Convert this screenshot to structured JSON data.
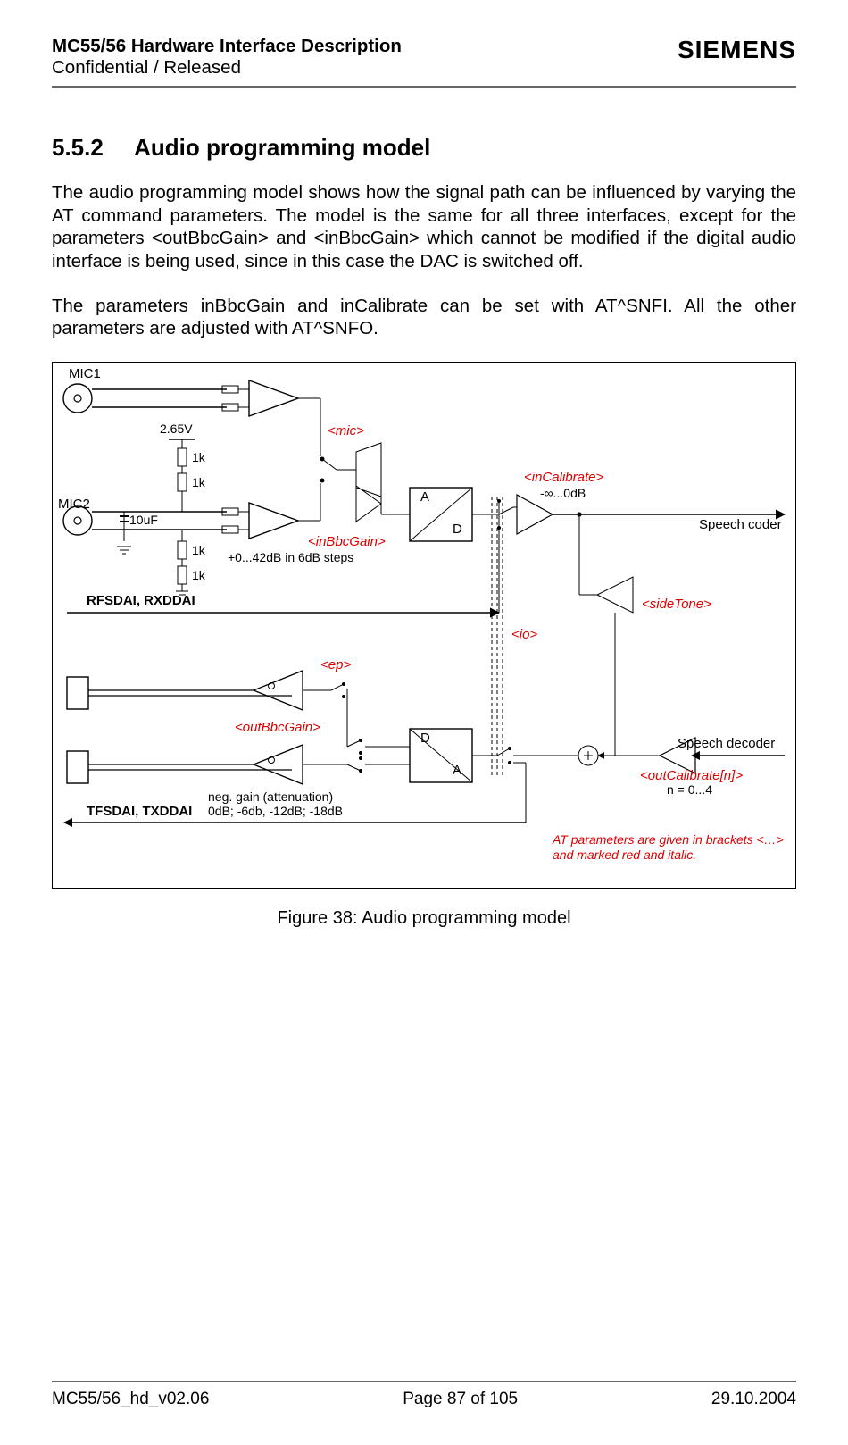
{
  "header": {
    "title": "MC55/56 Hardware Interface Description",
    "subtitle": "Confidential / Released",
    "logo": "SIEMENS"
  },
  "section": {
    "number": "5.5.2",
    "title": "Audio programming model",
    "para1": "The audio programming model shows how the signal path can be influenced by varying the AT command parameters. The model is the same for all three interfaces, except for the parameters <outBbcGain> and <inBbcGain> which cannot be modified if the digital audio interface is being used, since in this case the DAC is switched off.",
    "para2": "The parameters inBbcGain and inCalibrate can be set with AT^SNFI. All the other parameters are adjusted with AT^SNFO."
  },
  "diagram": {
    "labels": {
      "mic1": "MIC1",
      "mic2": "MIC2",
      "v": "2.65V",
      "r1": "1k",
      "r2": "1k",
      "r3": "1k",
      "r4": "1k",
      "cap": "10uF",
      "rx": "RFSDAI, RXDDAI",
      "tx": "TFSDAI, TXDDAI",
      "mic_param": "<mic>",
      "inBbc": "<inBbcGain>",
      "inBbc_note": "+0...42dB in 6dB steps",
      "inCal": "<inCalibrate>",
      "inCal_note": "-∞...0dB",
      "sideTone": "<sideTone>",
      "io": "<io>",
      "ep": "<ep>",
      "outBbc": "<outBbcGain>",
      "neg_gain1": "neg. gain (attenuation)",
      "neg_gain2": "0dB; -6db, -12dB; -18dB",
      "outCal": "<outCalibrate[n]>",
      "outCal_note": "n = 0...4",
      "speech_coder": "Speech coder",
      "speech_decoder": "Speech decoder",
      "footnote": "AT parameters are given in brackets <…> and marked red and italic.",
      "adc_a": "A",
      "adc_d": "D",
      "dac_d": "D",
      "dac_a": "A"
    },
    "caption": "Figure 38: Audio programming model"
  },
  "footer": {
    "left": "MC55/56_hd_v02.06",
    "center": "Page 87 of 105",
    "right": "29.10.2004"
  }
}
